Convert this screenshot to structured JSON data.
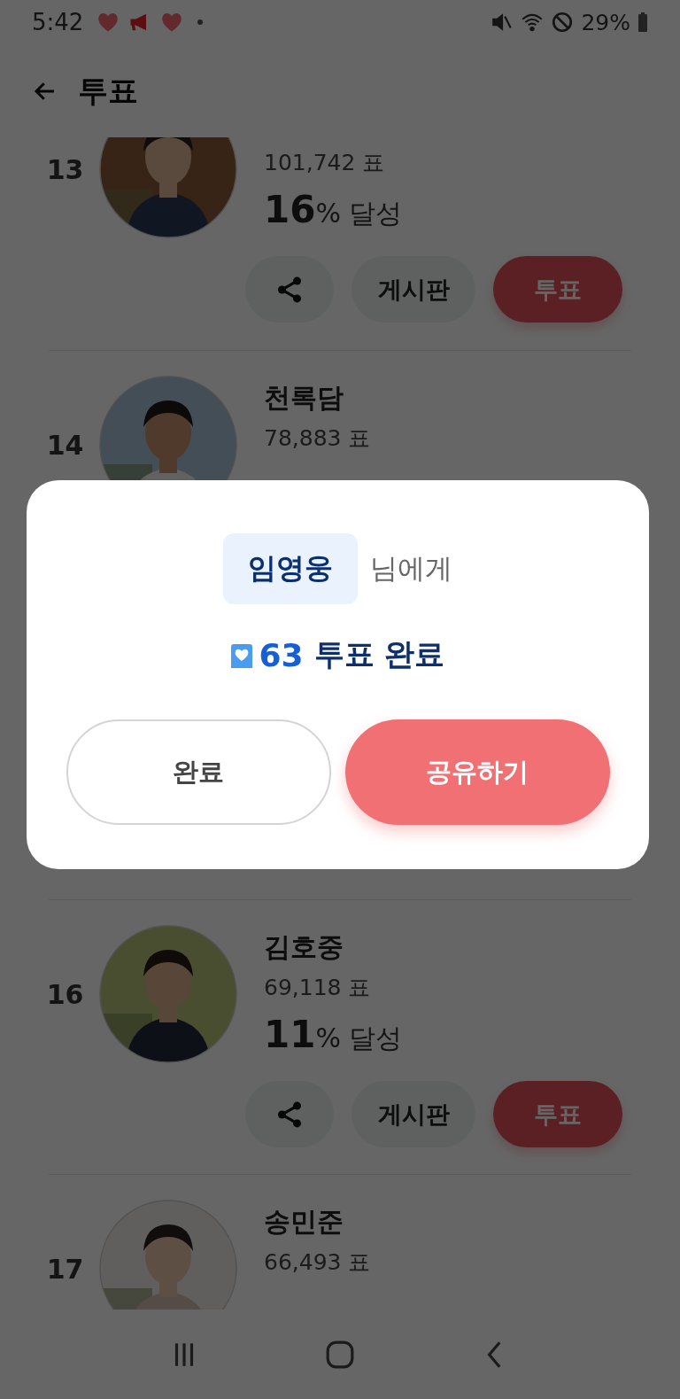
{
  "status_bar": {
    "time": "5:42",
    "battery": "29%"
  },
  "header": {
    "title": "투표"
  },
  "candidates": [
    {
      "rank": "13",
      "votes": "101,742 표",
      "percent": "16",
      "percent_suffix": "% 달성",
      "board_button": "게시판",
      "vote_button": "투표"
    },
    {
      "rank": "14",
      "name": "천록담",
      "votes": "78,883 표"
    },
    {
      "rank": "16",
      "name": "김호중",
      "votes": "69,118 표",
      "percent": "11",
      "percent_suffix": "% 달성",
      "board_button": "게시판",
      "vote_button": "투표"
    },
    {
      "rank": "17",
      "name": "송민준",
      "votes": "66,493 표"
    }
  ],
  "dialog": {
    "recipient": "임영웅",
    "recipient_suffix": "님에게",
    "vote_count": "63",
    "vote_label": "투표 완료",
    "buttons": [
      {
        "label": "완료",
        "kind": "secondary"
      },
      {
        "label": "공유하기",
        "kind": "primary"
      }
    ]
  }
}
